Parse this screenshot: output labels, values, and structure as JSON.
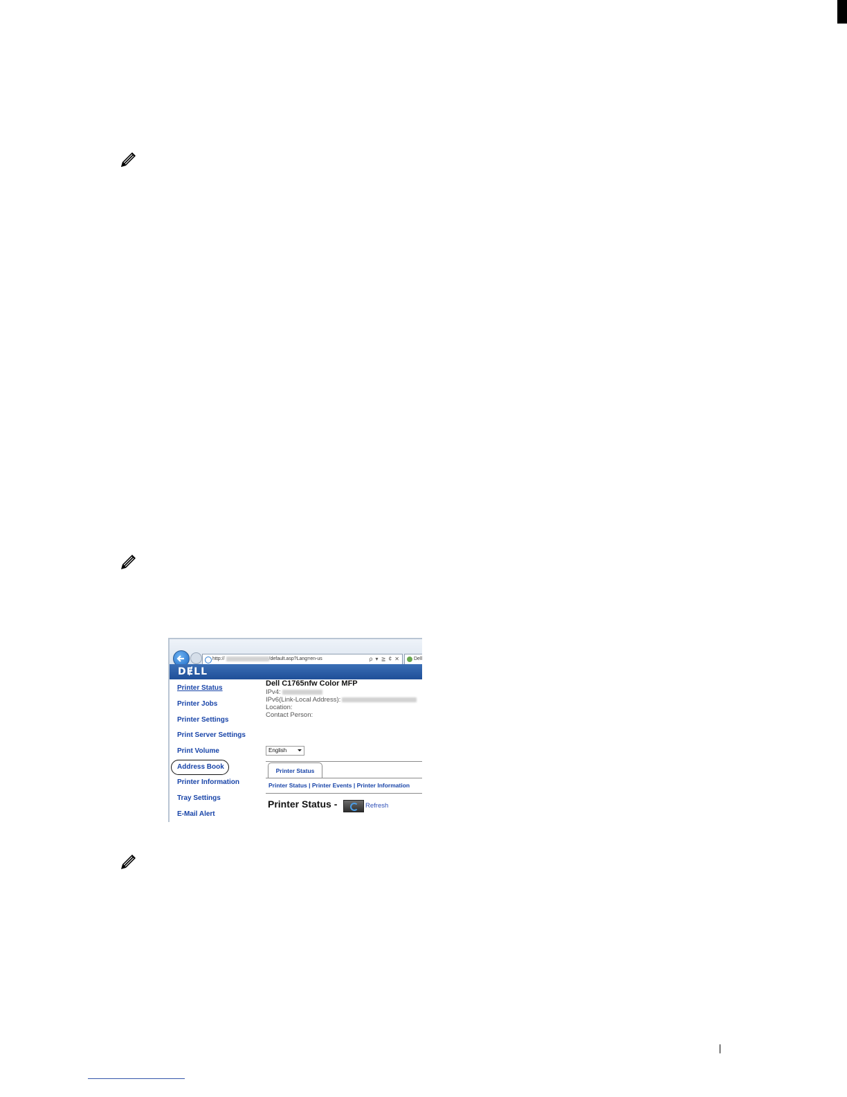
{
  "browser": {
    "address_prefix": "http://",
    "address_suffix": "/default.asp?Lang=en-us",
    "address_tools": "ρ ▾ ≧ ¢ ✕",
    "tab_label": "Dell",
    "brand": "DɆLL"
  },
  "sidebar": {
    "items": [
      {
        "label": "Printer Status"
      },
      {
        "label": "Printer Jobs"
      },
      {
        "label": "Printer Settings"
      },
      {
        "label": "Print Server Settings"
      },
      {
        "label": "Print Volume"
      },
      {
        "label": "Address Book"
      },
      {
        "label": "Printer Information"
      },
      {
        "label": "Tray Settings"
      },
      {
        "label": "E-Mail Alert"
      }
    ]
  },
  "printer": {
    "model": "Dell C1765nfw Color MFP",
    "ipv4_label": "IPv4:",
    "ipv6_label": "IPv6(Link-Local Address):",
    "location_label": "Location:",
    "contact_label": "Contact Person:"
  },
  "language": {
    "selected": "English"
  },
  "tabs": {
    "active": "Printer Status"
  },
  "sublinks": "Printer Status | Printer Events | Printer Information",
  "heading": "Printer Status -",
  "refresh_label": "Refresh"
}
